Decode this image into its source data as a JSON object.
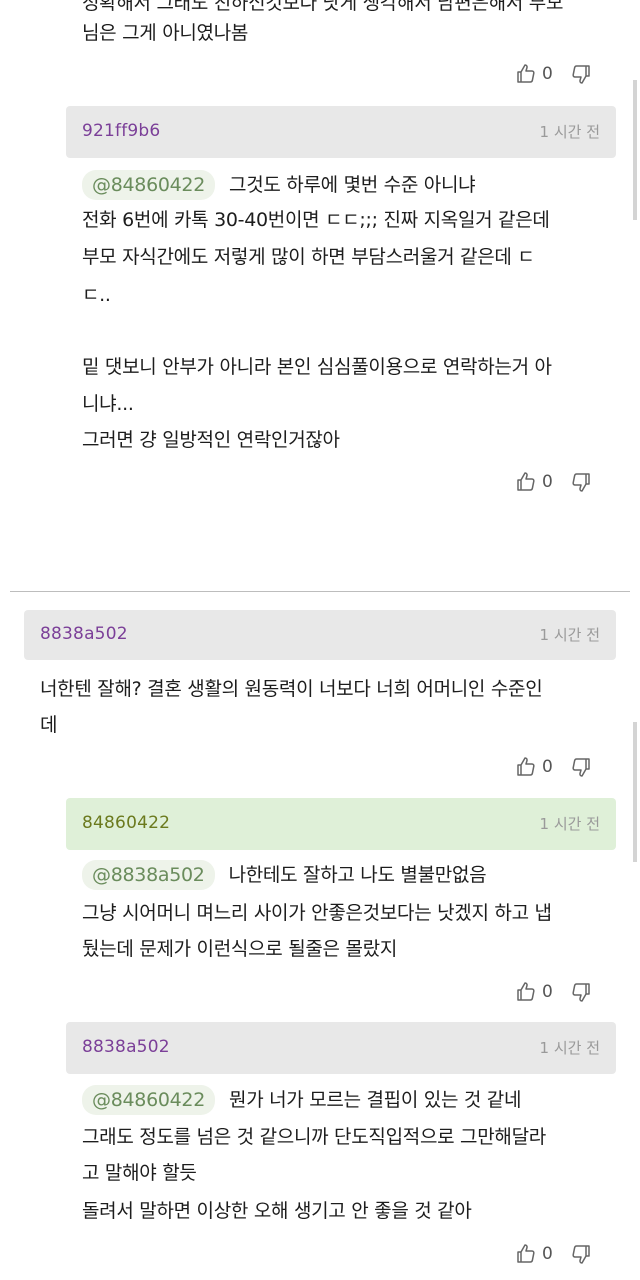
{
  "top_comment": {
    "line1": "정확해서 그래도 친하신것보다 낫게 생각해서 남편은해서 부모",
    "line2": "님은 그게 아니였나봄",
    "likes": "0"
  },
  "reply1": {
    "user": "921ff9b6",
    "time": "1 시간 전",
    "mention": "@84860422",
    "lines": [
      "그것도 하루에 몇번 수준 아니냐",
      "전화 6번에 카톡 30-40번이면 ㄷㄷ;;; 진짜 지옥일거 같은데",
      "부모 자식간에도 저렇게 많이 하면 부담스러울거 같은데 ㄷ",
      "ㄷ..",
      "",
      "밑 댓보니 안부가 아니라 본인 심심풀이용으로 연락하는거 아",
      "니냐...",
      "그러면 걍 일방적인 연락인거잖아"
    ],
    "likes": "0"
  },
  "comment2": {
    "user": "8838a502",
    "time": "1 시간 전",
    "lines": [
      "너한텐 잘해? 결혼 생활의 원동력이 너보다 너희 어머니인 수준인",
      "데"
    ],
    "likes": "0"
  },
  "reply2": {
    "user": "84860422",
    "time": "1 시간 전",
    "mention": "@8838a502",
    "lines": [
      "나한테도 잘하고 나도 별불만없음",
      "그냥 시어머니 며느리 사이가 안좋은것보다는 낫겠지 하고 냅",
      "뒀는데 문제가 이런식으로 될줄은 몰랐지"
    ],
    "likes": "0"
  },
  "reply3": {
    "user": "8838a502",
    "time": "1 시간 전",
    "mention": "@84860422",
    "lines": [
      "뭔가 너가 모르는 결핍이 있는 것 같네",
      "그래도 정도를 넘은 것 같으니까 단도직입적으로 그만해달라",
      "고 말해야 할듯",
      "돌려서 말하면 이상한 오해 생기고 안 좋을 것 같아"
    ],
    "likes": "0"
  },
  "colors": {
    "user_purple": "#7b3f98",
    "user_green": "#6b7a1e",
    "header_gray": "#e8e8e8",
    "header_green": "#dff0d8"
  },
  "icons": [
    "thumbs-up-icon",
    "thumbs-down-icon"
  ]
}
